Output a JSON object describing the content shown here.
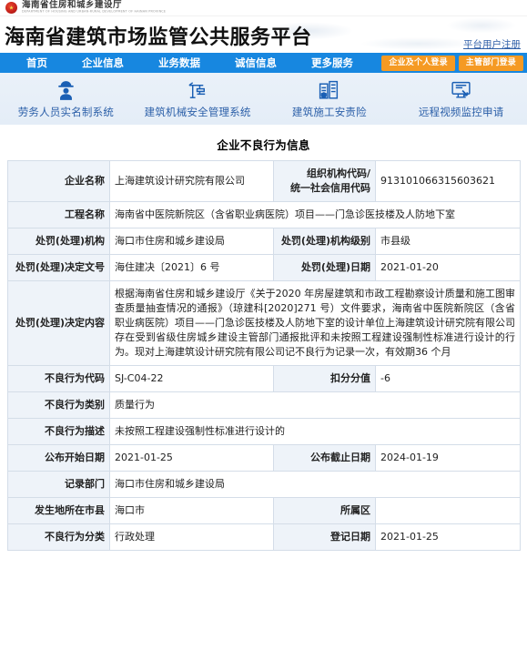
{
  "gov_bar": {
    "agency_cn": "海南省住房和城乡建设厅",
    "agency_en": "DEPARTMENT OF HOUSING AND URBAN-RURAL DEVELOPMENT OF HAINAN PROVINCE",
    "emblem_icon": "national-emblem-icon"
  },
  "header": {
    "platform_title": "海南省建筑市场监管公共服务平台",
    "register_link": "平台用户注册"
  },
  "nav": {
    "items": [
      {
        "label": "首页"
      },
      {
        "label": "企业信息"
      },
      {
        "label": "业务数据"
      },
      {
        "label": "诚信信息"
      },
      {
        "label": "更多服务"
      }
    ],
    "login_buttons": [
      {
        "label": "企业及个人登录"
      },
      {
        "label": "主管部门登录"
      }
    ],
    "bar_color": "#1787e0",
    "login_button_color": "#f59a23"
  },
  "services": [
    {
      "label": "劳务人员实名制系统",
      "icon": "worker-helmet-icon"
    },
    {
      "label": "建筑机械安全管理系统",
      "icon": "tower-crane-icon"
    },
    {
      "label": "建筑施工安责险",
      "icon": "building-shield-icon"
    },
    {
      "label": "远程视频监控申请",
      "icon": "remote-video-monitor-icon"
    }
  ],
  "page": {
    "title": "企业不良行为信息"
  },
  "record": {
    "company_name_label": "企业名称",
    "company_name_value": "上海建筑设计研究院有限公司",
    "org_code_label": "组织机构代码/",
    "org_code_label2": "统一社会信用代码",
    "org_code_value": "913101066315603621",
    "project_name_label": "工程名称",
    "project_name_value": "海南省中医院新院区（含省职业病医院）项目——门急诊医技楼及人防地下室",
    "punish_org_label": "处罚(处理)机构",
    "punish_org_value": "海口市住房和城乡建设局",
    "punish_org_level_label": "处罚(处理)机构级别",
    "punish_org_level_value": "市县级",
    "decision_doc_label": "处罚(处理)决定文号",
    "decision_doc_value": "海住建决〔2021〕6 号",
    "punish_date_label": "处罚(处理)日期",
    "punish_date_value": "2021-01-20",
    "decision_content_label": "处罚(处理)决定内容",
    "decision_content_value": "根据海南省住房和城乡建设厅《关于2020 年房屋建筑和市政工程勘察设计质量和施工图审查质量抽查情况的通报》（琼建科[2020]271 号）文件要求，海南省中医院新院区（含省职业病医院）项目——门急诊医技楼及人防地下室的设计单位上海建筑设计研究院有限公司存在受到省级住房城乡建设主管部门通报批评和未按照工程建设强制性标准进行设计的行为。现对上海建筑设计研究院有限公司记不良行为记录一次，有效期36 个月",
    "bad_behavior_code_label": "不良行为代码",
    "bad_behavior_code_value": "SJ-C04-22",
    "deduction_label": "扣分分值",
    "deduction_value": "-6",
    "bad_behavior_type_label": "不良行为类别",
    "bad_behavior_type_value": "质量行为",
    "bad_behavior_desc_label": "不良行为描述",
    "bad_behavior_desc_value": "未按照工程建设强制性标准进行设计的",
    "publish_start_label": "公布开始日期",
    "publish_start_value": "2021-01-25",
    "publish_end_label": "公布截止日期",
    "publish_end_value": "2024-01-19",
    "record_dept_label": "记录部门",
    "record_dept_value": "海口市住房和城乡建设局",
    "city_county_label": "发生地所在市县",
    "city_county_value": "海口市",
    "district_label": "所属区",
    "district_value": "",
    "bad_behavior_class_label": "不良行为分类",
    "bad_behavior_class_value": "行政处理",
    "register_date_label": "登记日期",
    "register_date_value": "2021-01-25"
  }
}
